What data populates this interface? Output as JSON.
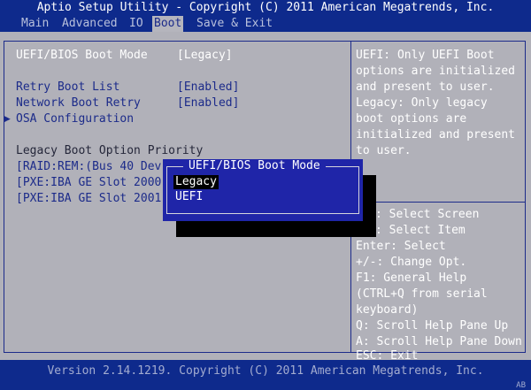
{
  "title": "Aptio Setup Utility - Copyright (C) 2011 American Megatrends, Inc.",
  "tabs": [
    "Main",
    "Advanced",
    "IO",
    "Boot",
    "Save & Exit"
  ],
  "active_tab": "Boot",
  "settings": {
    "boot_mode_label": "UEFI/BIOS Boot Mode",
    "boot_mode_value": "[Legacy]",
    "retry_label": "Retry Boot List",
    "retry_value": "[Enabled]",
    "net_retry_label": "Network Boot Retry",
    "net_retry_value": "[Enabled]",
    "osa_label": "OSA Configuration",
    "priority_heading": "Legacy Boot Option Priority",
    "priority_items": [
      "[RAID:REM:(Bus 40 Dev",
      "[PXE:IBA GE Slot 2000",
      "[PXE:IBA GE Slot 2001"
    ]
  },
  "help_text": [
    "UEFI: Only UEFI Boot",
    "options are initialized",
    "and present to user.",
    "Legacy: Only legacy",
    "boot options are",
    "initialized and present",
    "to user."
  ],
  "key_help": [
    ": Select Screen",
    ": Select Item",
    "Enter: Select",
    "+/-: Change Opt.",
    "F1: General Help",
    "(CTRL+Q from serial",
    "keyboard)",
    "Q: Scroll Help Pane Up",
    "A: Scroll Help Pane Down",
    "ESC: Exit"
  ],
  "popup": {
    "title": "UEFI/BIOS Boot Mode",
    "options": [
      "Legacy",
      "UEFI"
    ],
    "selected": "Legacy"
  },
  "status": "Version 2.14.1219. Copyright (C) 2011 American Megatrends, Inc.",
  "corner_tag": "AB",
  "colors": {
    "background": "#0e2a8c",
    "panel": "#b1b1b9",
    "popup": "#1f25a8",
    "label": "#1c2b8a"
  }
}
